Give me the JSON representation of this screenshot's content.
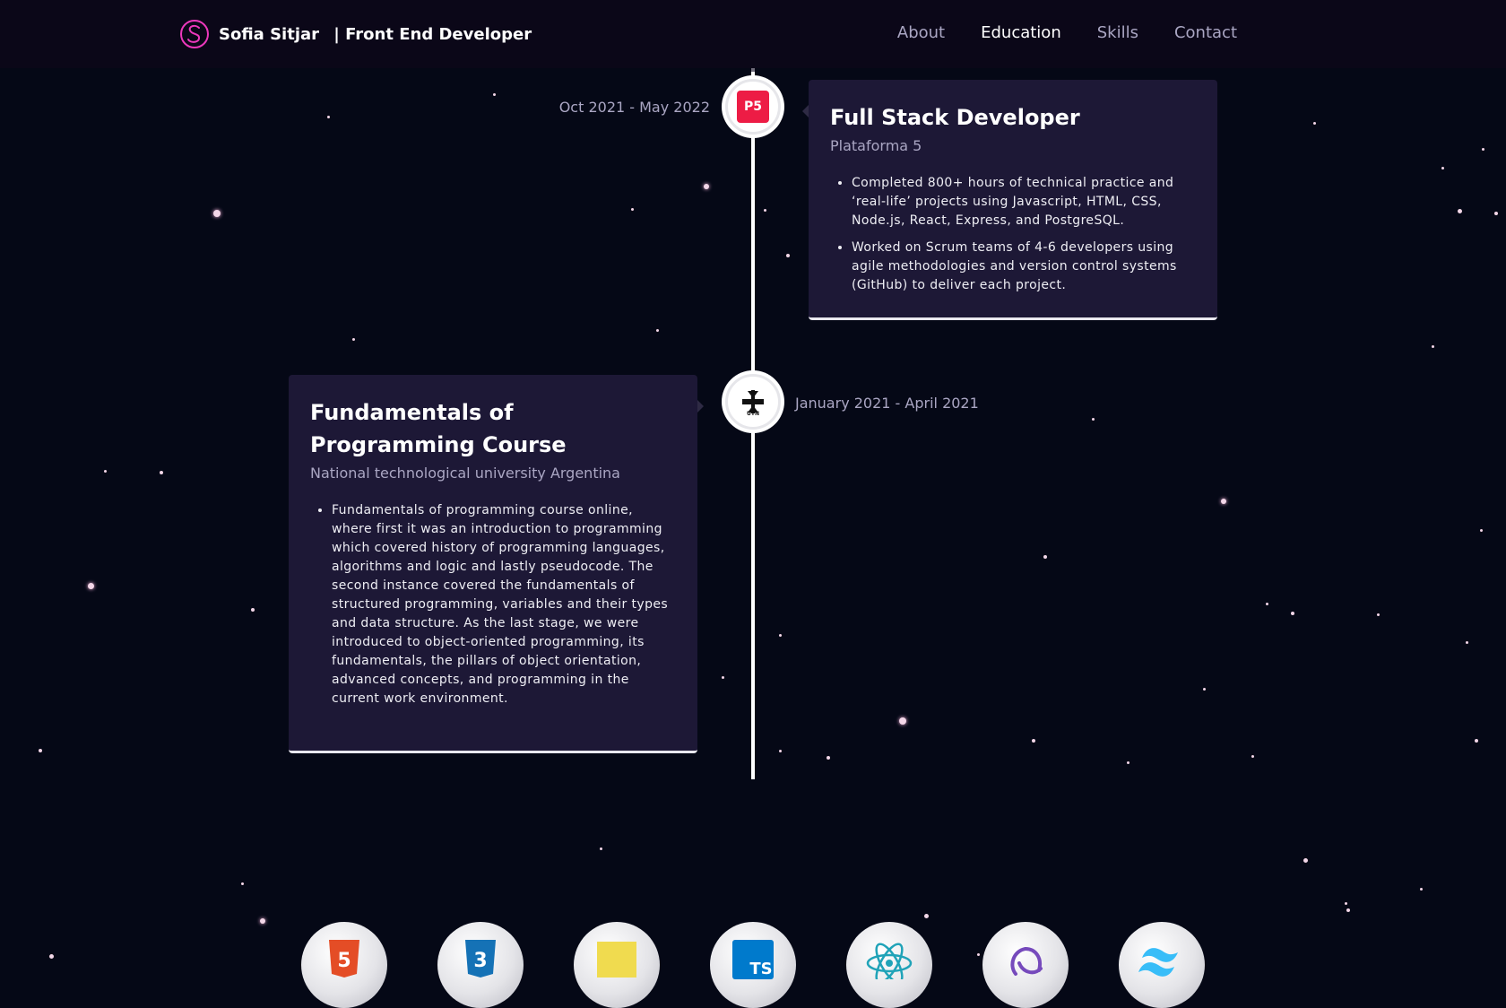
{
  "nav": {
    "brand_name": "Sofia Sitjar",
    "brand_role": " | Front End Developer",
    "links": [
      {
        "label": "About",
        "active": false
      },
      {
        "label": "Education",
        "active": true
      },
      {
        "label": "Skills",
        "active": false
      },
      {
        "label": "Contact",
        "active": false
      }
    ],
    "accent_color": "#ec38bc"
  },
  "timeline": [
    {
      "date": "Oct 2021 - May 2022",
      "title": "Full Stack Developer",
      "company": "Plataforma 5",
      "icon": "plataforma5-logo",
      "icon_text": "P5",
      "points": [
        "Completed 800+ hours of technical practice and ‘real-life’ projects using Javascript, HTML, CSS, Node.js, React, Express, and PostgreSQL.",
        "Worked on Scrum teams of 4-6 developers using agile methodologies and version control systems (GitHub) to deliver each project."
      ]
    },
    {
      "date": "January 2021 - April 2021",
      "title": "Fundamentals of Programming Course",
      "company": "National technological university Argentina",
      "icon": "utn-logo",
      "icon_text": "UTN",
      "points": [
        "Fundamentals of programming course online, where first it was an introduction to programming which covered history of programming languages, algorithms and logic and lastly pseudocode. The second instance covered the fundamentals of structured programming, variables and their types and data structure. As the last stage, we were introduced to object-oriented programming, its fundamentals, the pillars of object orientation, advanced concepts, and programming in the current work environment."
      ]
    }
  ],
  "skills": [
    {
      "name": "html5-icon",
      "color": "#e44d26"
    },
    {
      "name": "css3-icon",
      "color": "#1572b6"
    },
    {
      "name": "javascript-icon",
      "color": "#f0db4f"
    },
    {
      "name": "typescript-icon",
      "color": "#007acc",
      "text": "TS"
    },
    {
      "name": "react-icon",
      "color": "#20a3b8"
    },
    {
      "name": "redux-icon",
      "color": "#764abc"
    },
    {
      "name": "tailwind-icon",
      "color": "#38bdf8"
    }
  ]
}
